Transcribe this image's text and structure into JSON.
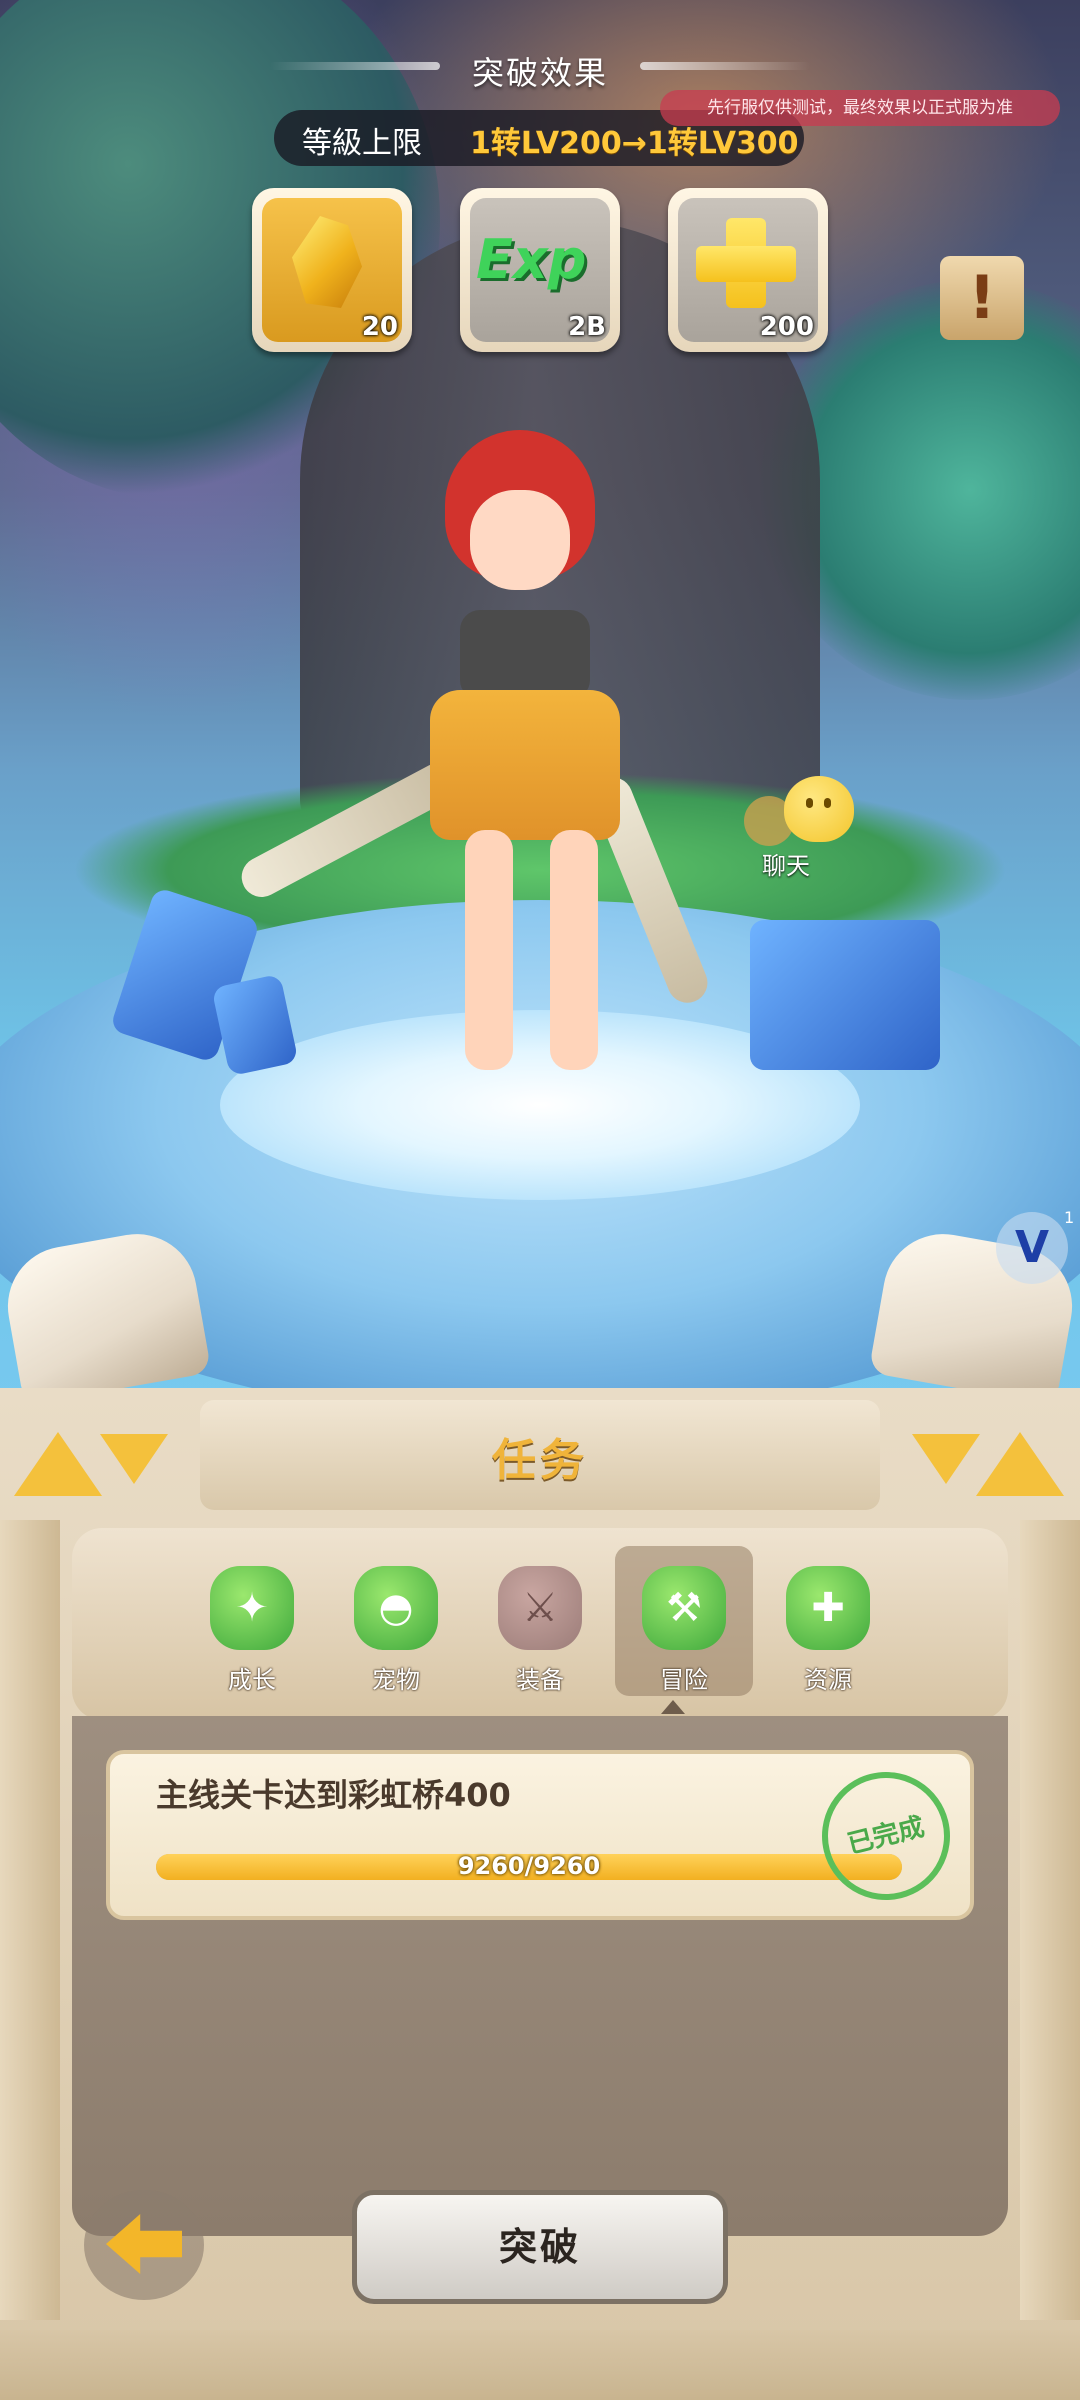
{
  "hud": {
    "title": "突破效果",
    "level_cap_label": "等級上限",
    "level_cap_value": "1转LV200→1转LV300",
    "test_notice": "先行服仅供测试，最终效果以正式服为准"
  },
  "rewards": [
    {
      "icon": "gold-crystal-icon",
      "qty": "20",
      "highlighted": true
    },
    {
      "icon": "exp-icon",
      "label": "Exp",
      "qty": "2B",
      "highlighted": false
    },
    {
      "icon": "yellow-plus-icon",
      "qty": "200",
      "highlighted": false
    }
  ],
  "scene": {
    "chat_label": "聊天",
    "v_badge": "V",
    "v_count": "1",
    "alert_icon": "!"
  },
  "panel": {
    "title": "任务",
    "tabs": [
      {
        "label": "成长",
        "icon": "growth-icon",
        "active": false
      },
      {
        "label": "宠物",
        "icon": "pet-icon",
        "active": false
      },
      {
        "label": "装备",
        "icon": "equipment-icon",
        "active": false,
        "locked": true
      },
      {
        "label": "冒险",
        "icon": "adventure-icon",
        "active": true
      },
      {
        "label": "资源",
        "icon": "resource-bone-icon",
        "active": false
      }
    ],
    "task": {
      "text": "主线关卡达到彩虹桥400",
      "progress_text": "9260/9260",
      "progress_fraction": 1.0,
      "status": "已完成"
    },
    "breakthrough_button": "突破"
  },
  "colors": {
    "accent_gold": "#f4c13c",
    "complete_green": "#4aa94a",
    "panel_beige": "#e9dcc6"
  }
}
